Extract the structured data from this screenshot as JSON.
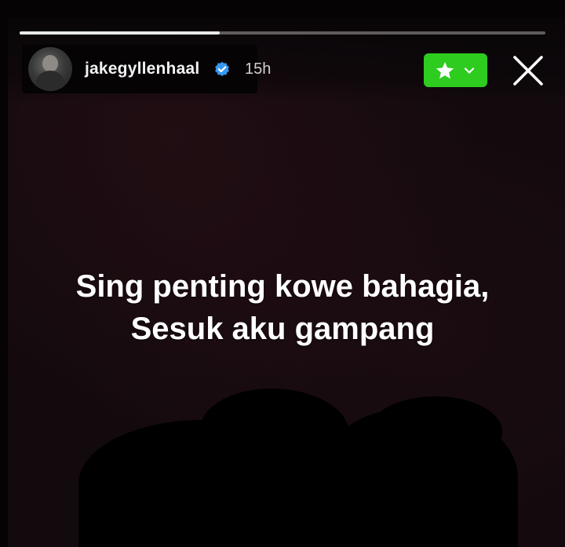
{
  "story": {
    "progress_fraction": 0.38
  },
  "header": {
    "username": "jakegyllenhaal",
    "verified": true,
    "time_ago": "15h",
    "close_friends_icon": "star-icon",
    "close_icon": "close-icon"
  },
  "caption": {
    "line1": "Sing penting kowe bahagia,",
    "line2": "Sesuk aku gampang"
  },
  "colors": {
    "close_friends_green": "#2ecc1f",
    "verified_blue": "#3897f0",
    "background": "#120a0d"
  }
}
